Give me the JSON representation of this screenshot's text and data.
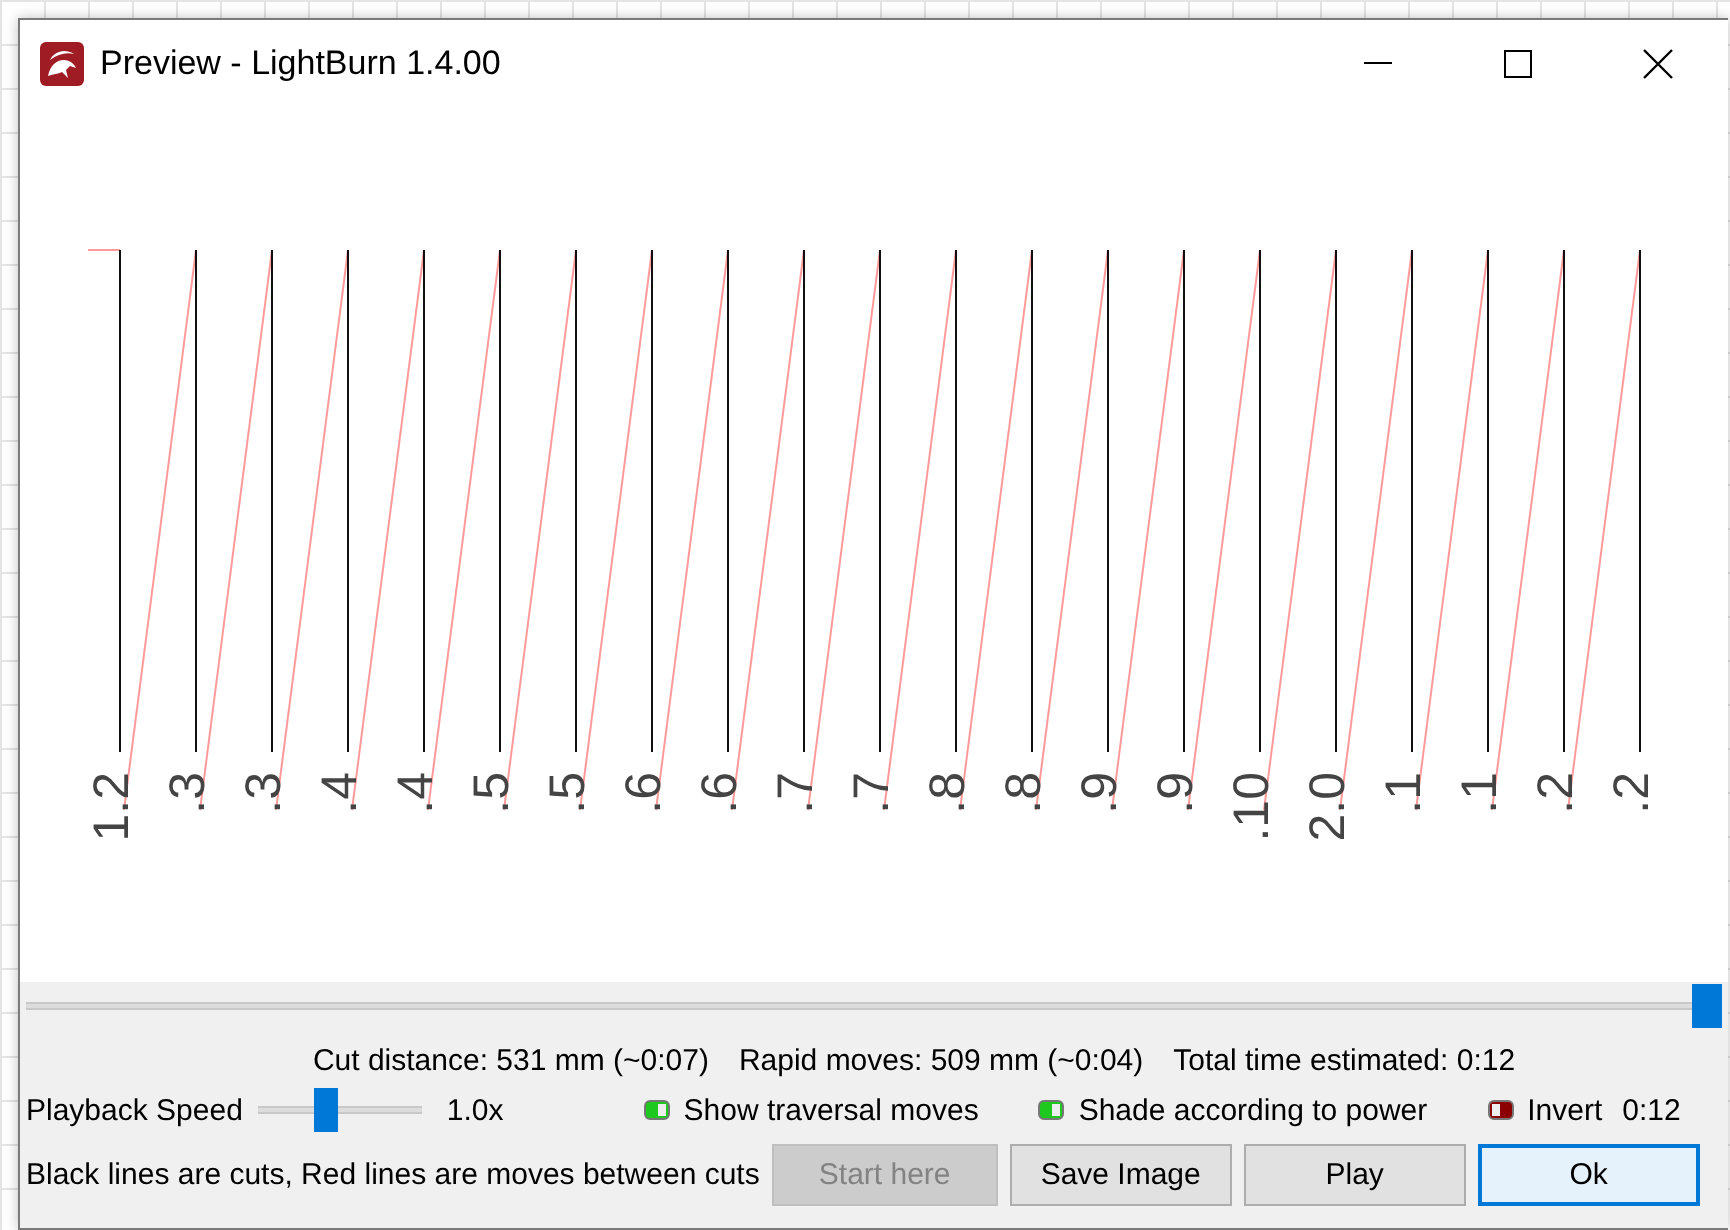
{
  "window": {
    "title": "Preview - LightBurn 1.4.00"
  },
  "preview": {
    "labels": [
      "1.2",
      ".3",
      ".3",
      ".4",
      ".4",
      ".5",
      ".5",
      ".6",
      ".6",
      ".7",
      ".7",
      ".8",
      ".8",
      ".9",
      ".9",
      ".10",
      "2.0",
      ".1",
      ".1",
      ".2",
      ".2"
    ]
  },
  "timeline": {
    "level": 1
  },
  "stats": [
    "Cut distance: 531 mm (~0:07)",
    "Rapid moves: 509 mm (~0:04)",
    "Total time estimated: 0:12"
  ],
  "playback": {
    "label": "Playback Speed",
    "level": 0.4,
    "reading": "1.0x"
  },
  "toggles": [
    {
      "label": "Show traversal moves",
      "on": true
    },
    {
      "label": "Shade according to power",
      "on": true
    },
    {
      "label": "Invert",
      "on": false
    }
  ],
  "time": "0:12",
  "legend": "Black lines are cuts, Red lines are moves between cuts",
  "buttons": [
    {
      "label": "Start here",
      "disabled": true,
      "default": false
    },
    {
      "label": "Save Image",
      "disabled": false,
      "default": false
    },
    {
      "label": "Play",
      "disabled": false,
      "default": false
    },
    {
      "label": "Ok",
      "disabled": false,
      "default": true
    }
  ]
}
